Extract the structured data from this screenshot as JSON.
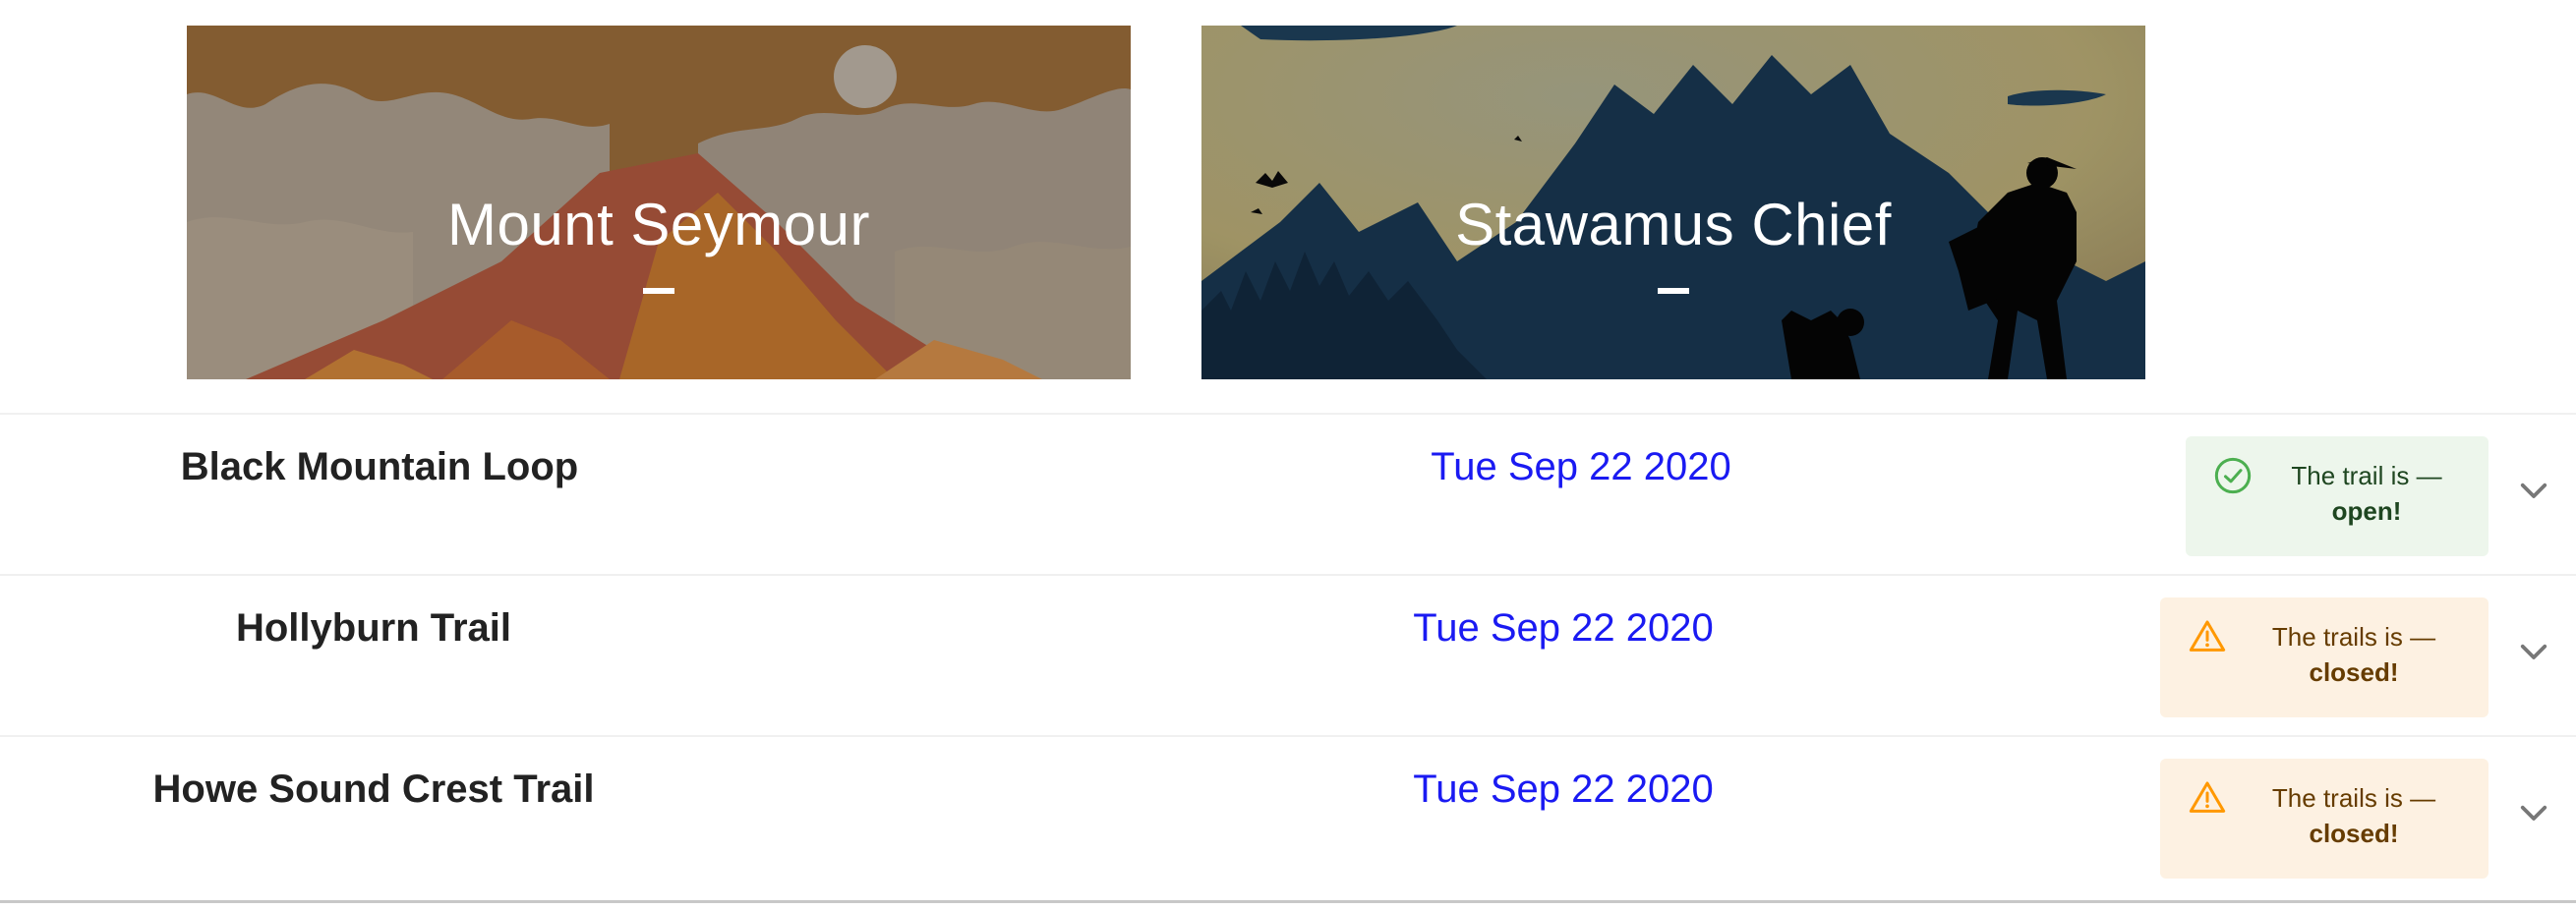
{
  "cards": [
    {
      "title": "Mount Seymour",
      "dash": "–"
    },
    {
      "title": "Stawamus Chief",
      "dash": "–"
    }
  ],
  "trails": [
    {
      "name": "Black Mountain Loop",
      "date": "Tue Sep 22 2020",
      "status": "open",
      "status_line1": "The trail is —",
      "status_line2": "open!",
      "icon": "check-circle-icon"
    },
    {
      "name": "Hollyburn Trail",
      "date": "Tue Sep 22 2020",
      "status": "closed",
      "status_line1": "The trails is —",
      "status_line2": "closed!",
      "icon": "warning-triangle-icon"
    },
    {
      "name": "Howe Sound Crest Trail",
      "date": "Tue Sep 22 2020",
      "status": "closed",
      "status_line1": "The trails is —",
      "status_line2": "closed!",
      "icon": "warning-triangle-icon"
    }
  ],
  "colors": {
    "date_link": "#1a1af2",
    "open_bg": "#edf6ec",
    "open_icon": "#4caf50",
    "closed_bg": "#fdf1e2",
    "closed_icon": "#ff9800"
  },
  "chevron_icon": "chevron-down-icon"
}
